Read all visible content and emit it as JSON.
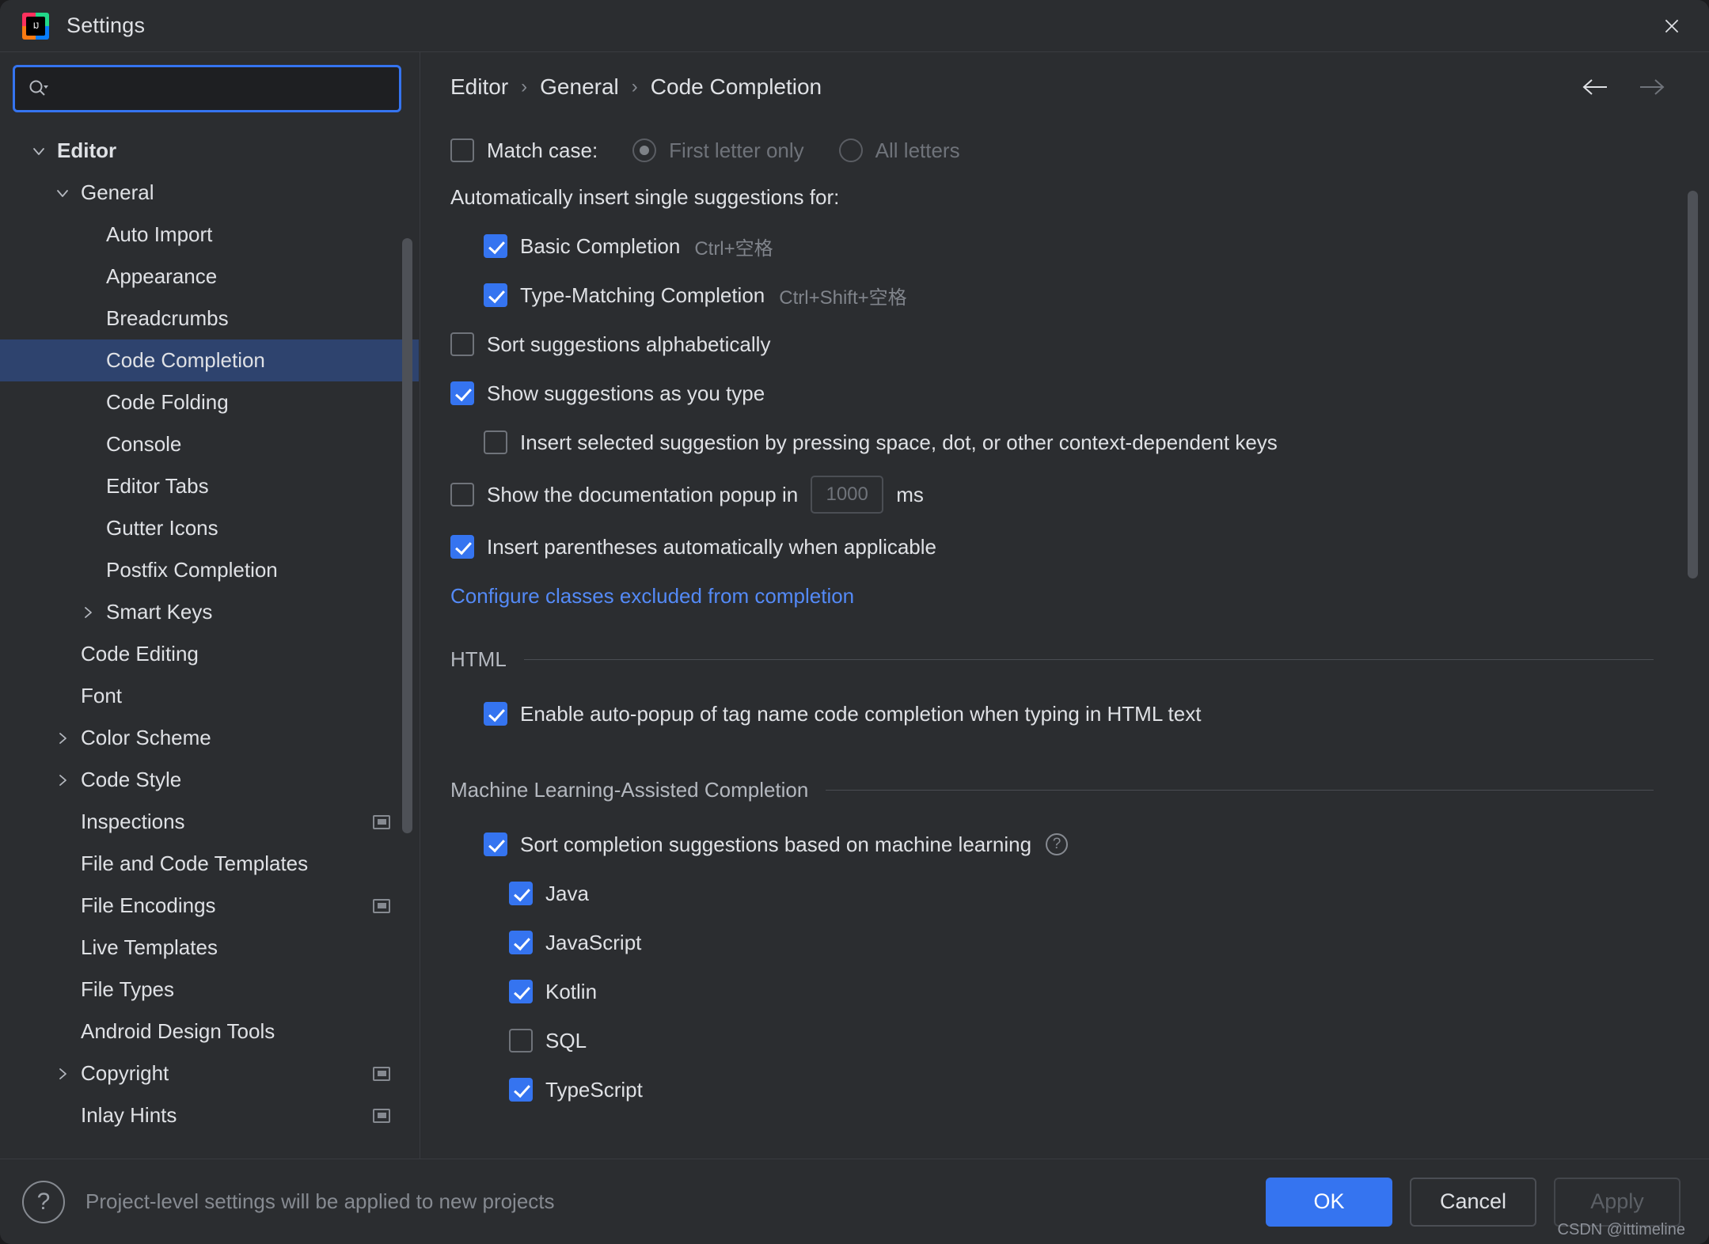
{
  "window": {
    "title": "Settings",
    "app_icon": "intellij-idea-icon",
    "close_icon": "close-icon"
  },
  "sidebar": {
    "search": {
      "placeholder": "",
      "value": "",
      "icon": "search-icon"
    },
    "items": [
      {
        "label": "Editor",
        "level": 0,
        "twisty": "down",
        "selected": false,
        "bold": true,
        "badge": false
      },
      {
        "label": "General",
        "level": 1,
        "twisty": "down",
        "selected": false,
        "bold": false,
        "badge": false
      },
      {
        "label": "Auto Import",
        "level": 2,
        "twisty": "none",
        "selected": false,
        "bold": false,
        "badge": false
      },
      {
        "label": "Appearance",
        "level": 2,
        "twisty": "none",
        "selected": false,
        "bold": false,
        "badge": false
      },
      {
        "label": "Breadcrumbs",
        "level": 2,
        "twisty": "none",
        "selected": false,
        "bold": false,
        "badge": false
      },
      {
        "label": "Code Completion",
        "level": 2,
        "twisty": "none",
        "selected": true,
        "bold": false,
        "badge": false
      },
      {
        "label": "Code Folding",
        "level": 2,
        "twisty": "none",
        "selected": false,
        "bold": false,
        "badge": false
      },
      {
        "label": "Console",
        "level": 2,
        "twisty": "none",
        "selected": false,
        "bold": false,
        "badge": false
      },
      {
        "label": "Editor Tabs",
        "level": 2,
        "twisty": "none",
        "selected": false,
        "bold": false,
        "badge": false
      },
      {
        "label": "Gutter Icons",
        "level": 2,
        "twisty": "none",
        "selected": false,
        "bold": false,
        "badge": false
      },
      {
        "label": "Postfix Completion",
        "level": 2,
        "twisty": "none",
        "selected": false,
        "bold": false,
        "badge": false
      },
      {
        "label": "Smart Keys",
        "level": 2,
        "twisty": "right",
        "selected": false,
        "bold": false,
        "badge": false
      },
      {
        "label": "Code Editing",
        "level": 1,
        "twisty": "none",
        "selected": false,
        "bold": false,
        "badge": false
      },
      {
        "label": "Font",
        "level": 1,
        "twisty": "none",
        "selected": false,
        "bold": false,
        "badge": false
      },
      {
        "label": "Color Scheme",
        "level": 1,
        "twisty": "right",
        "selected": false,
        "bold": false,
        "badge": false
      },
      {
        "label": "Code Style",
        "level": 1,
        "twisty": "right",
        "selected": false,
        "bold": false,
        "badge": false
      },
      {
        "label": "Inspections",
        "level": 1,
        "twisty": "none",
        "selected": false,
        "bold": false,
        "badge": true
      },
      {
        "label": "File and Code Templates",
        "level": 1,
        "twisty": "none",
        "selected": false,
        "bold": false,
        "badge": false
      },
      {
        "label": "File Encodings",
        "level": 1,
        "twisty": "none",
        "selected": false,
        "bold": false,
        "badge": true
      },
      {
        "label": "Live Templates",
        "level": 1,
        "twisty": "none",
        "selected": false,
        "bold": false,
        "badge": false
      },
      {
        "label": "File Types",
        "level": 1,
        "twisty": "none",
        "selected": false,
        "bold": false,
        "badge": false
      },
      {
        "label": "Android Design Tools",
        "level": 1,
        "twisty": "none",
        "selected": false,
        "bold": false,
        "badge": false
      },
      {
        "label": "Copyright",
        "level": 1,
        "twisty": "right",
        "selected": false,
        "bold": false,
        "badge": true
      },
      {
        "label": "Inlay Hints",
        "level": 1,
        "twisty": "none",
        "selected": false,
        "bold": false,
        "badge": true
      }
    ]
  },
  "breadcrumb": {
    "items": [
      "Editor",
      "General",
      "Code Completion"
    ],
    "separator": "›",
    "back_icon": "arrow-left-icon",
    "forward_icon": "arrow-right-icon"
  },
  "main": {
    "match_case": {
      "label": "Match case:",
      "checked": false,
      "options": [
        {
          "label": "First letter only",
          "selected": true,
          "disabled": true
        },
        {
          "label": "All letters",
          "selected": false,
          "disabled": true
        }
      ]
    },
    "auto_insert_heading": "Automatically insert single suggestions for:",
    "auto_insert": [
      {
        "label": "Basic Completion",
        "shortcut": "Ctrl+空格",
        "checked": true
      },
      {
        "label": "Type-Matching Completion",
        "shortcut": "Ctrl+Shift+空格",
        "checked": true
      }
    ],
    "sort_alphabetically": {
      "label": "Sort suggestions alphabetically",
      "checked": false
    },
    "show_as_you_type": {
      "label": "Show suggestions as you type",
      "checked": true
    },
    "insert_selected": {
      "label": "Insert selected suggestion by pressing space, dot, or other context-dependent keys",
      "checked": false
    },
    "doc_popup": {
      "label_before": "Show the documentation popup in",
      "value": "1000",
      "unit": "ms",
      "checked": false,
      "field_disabled": true
    },
    "insert_parentheses": {
      "label": "Insert parentheses automatically when applicable",
      "checked": true
    },
    "excluded_link": "Configure classes excluded from completion",
    "html_section": {
      "title": "HTML",
      "auto_popup": {
        "label": "Enable auto-popup of tag name code completion when typing in HTML text",
        "checked": true
      }
    },
    "ml_section": {
      "title": "Machine Learning-Assisted Completion",
      "sort_ml": {
        "label": "Sort completion suggestions based on machine learning",
        "checked": true,
        "help_icon": "question-circle-icon"
      },
      "languages": [
        {
          "label": "Java",
          "checked": true
        },
        {
          "label": "JavaScript",
          "checked": true
        },
        {
          "label": "Kotlin",
          "checked": true
        },
        {
          "label": "SQL",
          "checked": false
        },
        {
          "label": "TypeScript",
          "checked": true
        }
      ]
    }
  },
  "footer": {
    "help_icon": "question-mark-icon",
    "note": "Project-level settings will be applied to new projects",
    "buttons": [
      {
        "label": "OK",
        "style": "primary",
        "disabled": false
      },
      {
        "label": "Cancel",
        "style": "secondary",
        "disabled": false
      },
      {
        "label": "Apply",
        "style": "disabled",
        "disabled": true
      }
    ],
    "watermark": "CSDN @ittimeline"
  },
  "colors": {
    "accent": "#3574f0",
    "selection": "#2e436e",
    "link": "#548af7",
    "panel": "#2b2d30",
    "text": "#dfe1e5",
    "muted": "#868a91"
  }
}
